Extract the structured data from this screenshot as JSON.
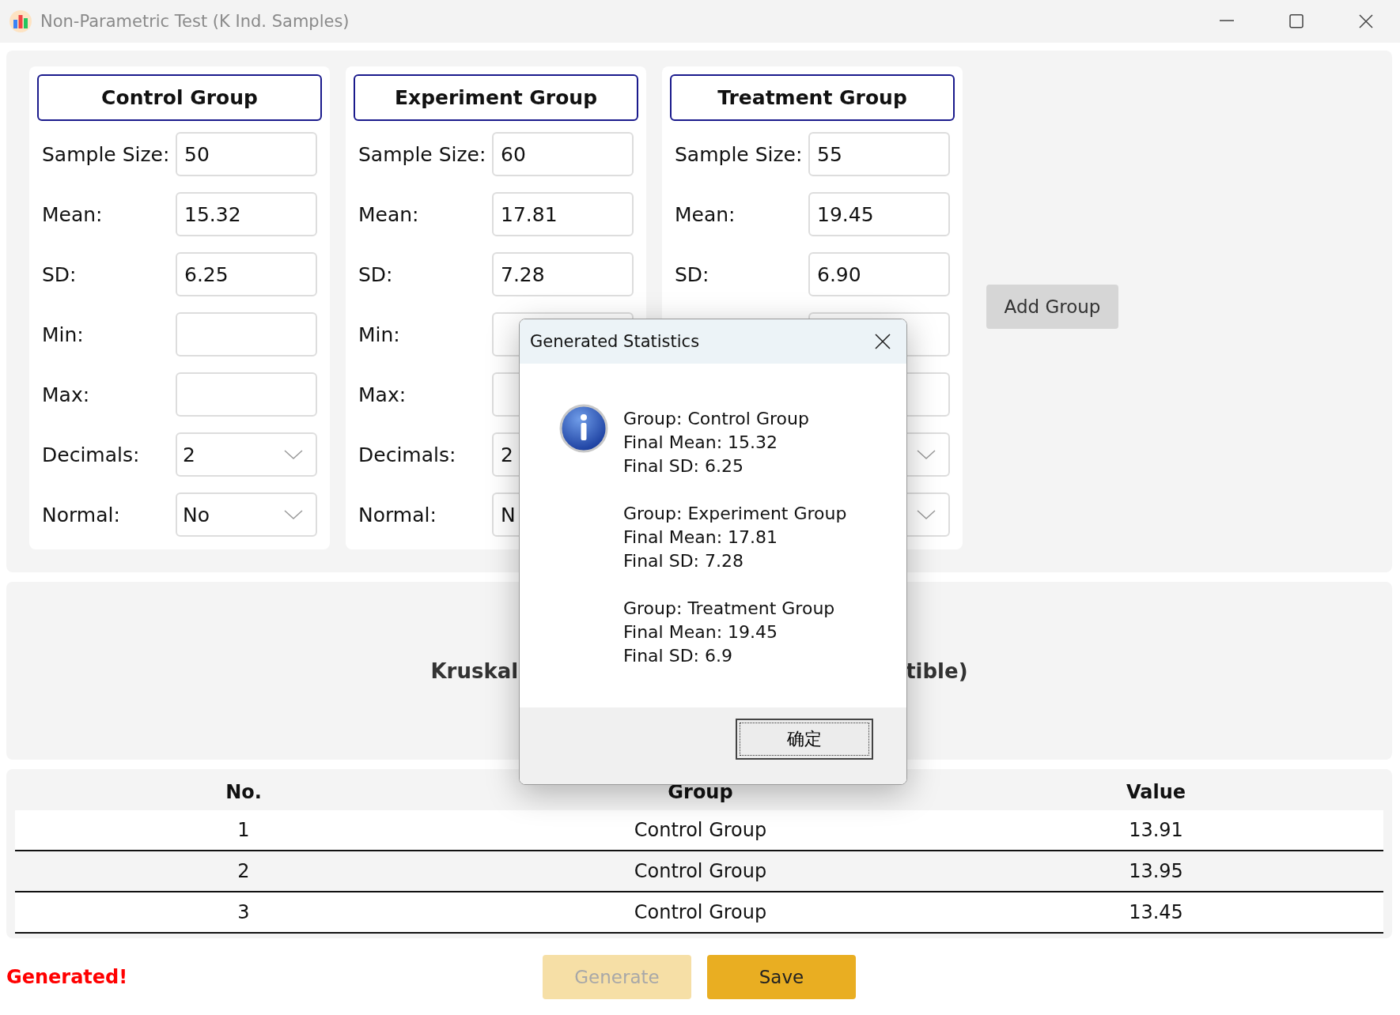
{
  "window": {
    "title": "Non-Parametric Test (K Ind. Samples)"
  },
  "groups": [
    {
      "name": "Control Group",
      "fields": [
        {
          "kind": "text",
          "label": "Sample Size:",
          "value": "50"
        },
        {
          "kind": "text",
          "label": "Mean:",
          "value": "15.32"
        },
        {
          "kind": "text",
          "label": "SD:",
          "value": "6.25"
        },
        {
          "kind": "text",
          "label": "Min:"
        },
        {
          "kind": "text",
          "label": "Max:"
        },
        {
          "kind": "dropdown",
          "label": "Decimals:",
          "value": "2"
        },
        {
          "kind": "dropdown",
          "label": "Normal:",
          "value": "No"
        }
      ]
    },
    {
      "name": "Experiment Group",
      "fields": [
        {
          "kind": "text",
          "label": "Sample Size:",
          "value": "60"
        },
        {
          "kind": "text",
          "label": "Mean:",
          "value": "17.81"
        },
        {
          "kind": "text",
          "label": "SD:",
          "value": "7.28"
        },
        {
          "kind": "text",
          "label": "Min:"
        },
        {
          "kind": "text",
          "label": "Max:"
        },
        {
          "kind": "text",
          "label": "Decimals:",
          "value": "2"
        },
        {
          "kind": "text",
          "label": "Normal:",
          "value": "N"
        }
      ]
    },
    {
      "name": "Treatment Group",
      "fields": [
        {
          "kind": "text",
          "label": "Sample Size:",
          "value": "55"
        },
        {
          "kind": "text",
          "label": "Mean:",
          "value": "19.45"
        },
        {
          "kind": "text",
          "label": "SD:",
          "value": "6.90"
        },
        {
          "kind": "text"
        },
        {
          "kind": "text"
        },
        {
          "kind": "dropdown"
        },
        {
          "kind": "dropdown"
        }
      ]
    }
  ],
  "add_group_button": "Add Group",
  "result": {
    "title_parts": [
      "Kruskal",
      "tible)"
    ]
  },
  "table": {
    "columns": [
      "No.",
      "Group",
      "Value"
    ],
    "rows": [
      [
        "1",
        "Control Group",
        "13.91"
      ],
      [
        "2",
        "Control Group",
        "13.95"
      ],
      [
        "3",
        "Control Group",
        "13.45"
      ]
    ]
  },
  "status": "Generated!",
  "buttons": [
    {
      "label": "Generate",
      "disabled": true
    },
    {
      "label": "Save",
      "disabled": false
    }
  ],
  "dialog": {
    "title": "Generated Statistics",
    "blocks": [
      [
        "Group: Control Group",
        "Final Mean: 15.32",
        "Final SD: 6.25"
      ],
      [
        "Group: Experiment Group",
        "Final Mean: 17.81",
        "Final SD: 7.28"
      ],
      [
        "Group: Treatment Group",
        "Final Mean: 19.45",
        "Final SD: 6.9"
      ]
    ],
    "ok_button": "确定"
  }
}
